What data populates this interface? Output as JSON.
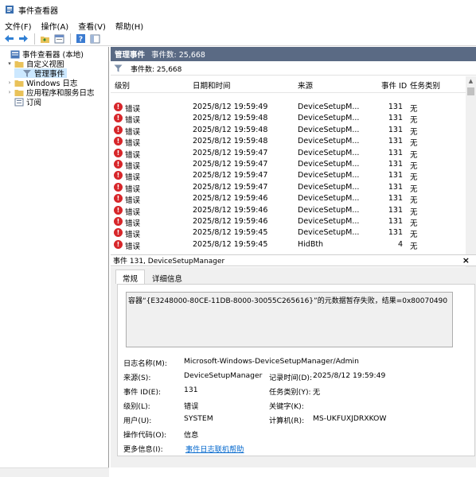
{
  "window": {
    "title": "事件查看器"
  },
  "menu": [
    "文件(F)",
    "操作(A)",
    "查看(V)",
    "帮助(H)"
  ],
  "toolbar": [
    "back-icon",
    "forward-icon",
    "folder-icon",
    "properties-icon",
    "help-icon",
    "console-icon"
  ],
  "tree": [
    {
      "label": "事件查看器 (本地)",
      "indent": 0,
      "expander": "",
      "icon": "event-viewer-icon"
    },
    {
      "label": "自定义视图",
      "indent": 1,
      "expander": "v",
      "icon": "folder-icon"
    },
    {
      "label": "管理事件",
      "indent": 2,
      "expander": "",
      "icon": "filter-icon",
      "selected": true
    },
    {
      "label": "Windows 日志",
      "indent": 1,
      "expander": ">",
      "icon": "folder-icon"
    },
    {
      "label": "应用程序和服务日志",
      "indent": 1,
      "expander": ">",
      "icon": "folder-icon"
    },
    {
      "label": "订阅",
      "indent": 1,
      "expander": "",
      "icon": "subscription-icon"
    }
  ],
  "header": {
    "title": "管理事件",
    "count_label": "事件数: 25,668"
  },
  "filter": {
    "count_label": "事件数: 25,668"
  },
  "columns": [
    "级别",
    "日期和时间",
    "来源",
    "事件 ID",
    "任务类别"
  ],
  "events": [
    {
      "level": "错误",
      "datetime": "2025/8/12 19:59:49",
      "source": "DeviceSetupM...",
      "id": "131",
      "category": "无"
    },
    {
      "level": "错误",
      "datetime": "2025/8/12 19:59:48",
      "source": "DeviceSetupM...",
      "id": "131",
      "category": "无"
    },
    {
      "level": "错误",
      "datetime": "2025/8/12 19:59:48",
      "source": "DeviceSetupM...",
      "id": "131",
      "category": "无"
    },
    {
      "level": "错误",
      "datetime": "2025/8/12 19:59:48",
      "source": "DeviceSetupM...",
      "id": "131",
      "category": "无"
    },
    {
      "level": "错误",
      "datetime": "2025/8/12 19:59:47",
      "source": "DeviceSetupM...",
      "id": "131",
      "category": "无"
    },
    {
      "level": "错误",
      "datetime": "2025/8/12 19:59:47",
      "source": "DeviceSetupM...",
      "id": "131",
      "category": "无"
    },
    {
      "level": "错误",
      "datetime": "2025/8/12 19:59:47",
      "source": "DeviceSetupM...",
      "id": "131",
      "category": "无"
    },
    {
      "level": "错误",
      "datetime": "2025/8/12 19:59:47",
      "source": "DeviceSetupM...",
      "id": "131",
      "category": "无"
    },
    {
      "level": "错误",
      "datetime": "2025/8/12 19:59:46",
      "source": "DeviceSetupM...",
      "id": "131",
      "category": "无"
    },
    {
      "level": "错误",
      "datetime": "2025/8/12 19:59:46",
      "source": "DeviceSetupM...",
      "id": "131",
      "category": "无"
    },
    {
      "level": "错误",
      "datetime": "2025/8/12 19:59:46",
      "source": "DeviceSetupM...",
      "id": "131",
      "category": "无"
    },
    {
      "level": "错误",
      "datetime": "2025/8/12 19:59:45",
      "source": "DeviceSetupM...",
      "id": "131",
      "category": "无"
    },
    {
      "level": "错误",
      "datetime": "2025/8/12 19:59:45",
      "source": "HidBth",
      "id": "4",
      "category": "无"
    }
  ],
  "detail": {
    "header": "事件 131, DeviceSetupManager",
    "close": "×",
    "tabs": [
      "常规",
      "详细信息"
    ],
    "message": "容器“{E3248000-80CE-11DB-8000-30055C265616}”的元数据暂存失败，结果=0x80070490",
    "fields": {
      "log_name_label": "日志名称(M):",
      "log_name": "Microsoft-Windows-DeviceSetupManager/Admin",
      "source_label": "来源(S):",
      "source": "DeviceSetupManager",
      "logged_label": "记录时间(D):",
      "logged": "2025/8/12 19:59:49",
      "event_id_label": "事件 ID(E):",
      "event_id": "131",
      "task_label": "任务类别(Y):",
      "task": "无",
      "level_label": "级别(L):",
      "level": "错误",
      "keywords_label": "关键字(K):",
      "keywords": "",
      "user_label": "用户(U):",
      "user": "SYSTEM",
      "computer_label": "计算机(R):",
      "computer": "MS-UKFUXJDRXKOW",
      "opcode_label": "操作代码(O):",
      "opcode": "信息",
      "more_label": "更多信息(I):",
      "more_link": "事件日志联机帮助"
    }
  }
}
